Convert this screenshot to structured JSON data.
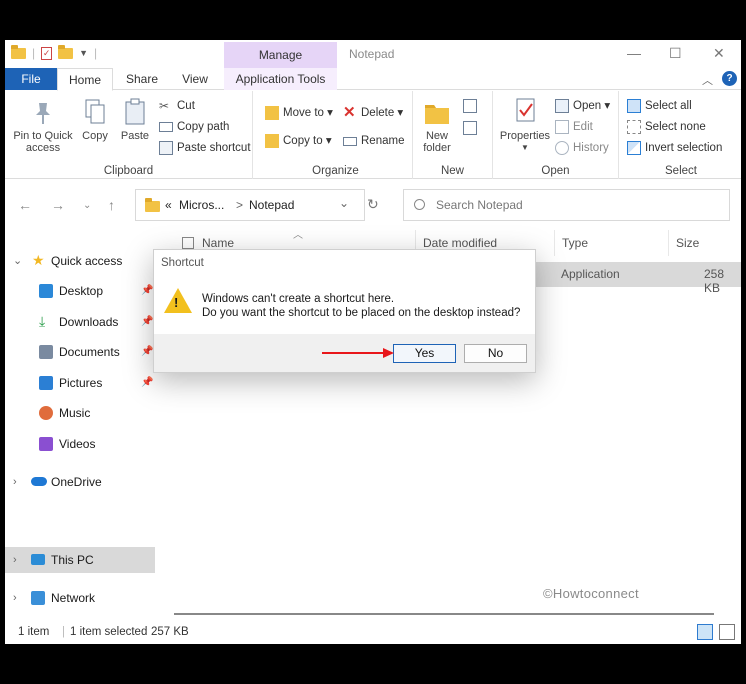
{
  "window": {
    "title": "Notepad",
    "manage_tab": "Manage",
    "controls": {
      "minimize": "—",
      "maximize": "☐",
      "close": "✕"
    }
  },
  "tabs": {
    "file": "File",
    "home": "Home",
    "share": "Share",
    "view": "View",
    "app_tools": "Application Tools"
  },
  "ribbon": {
    "clipboard": {
      "label": "Clipboard",
      "pin": "Pin to Quick access",
      "pin_l1": "Pin to Quick",
      "pin_l2": "access",
      "copy": "Copy",
      "paste": "Paste",
      "cut": "Cut",
      "copy_path": "Copy path",
      "paste_shortcut": "Paste shortcut"
    },
    "organize": {
      "label": "Organize",
      "move_to": "Move to ▾",
      "delete": "Delete ▾",
      "copy_to": "Copy to ▾",
      "rename": "Rename"
    },
    "new": {
      "label": "New",
      "new_folder_l1": "New",
      "new_folder_l2": "folder"
    },
    "open": {
      "label": "Open",
      "properties": "Properties",
      "open": "Open ▾",
      "edit": "Edit",
      "history": "History"
    },
    "select": {
      "label": "Select",
      "select_all": "Select all",
      "select_none": "Select none",
      "invert": "Invert selection"
    }
  },
  "address": {
    "crumb_prefix": "«",
    "crumb1": "Micros...",
    "sep": ">",
    "crumb2": "Notepad",
    "search_placeholder": "Search Notepad"
  },
  "nav": {
    "quick_access": "Quick access",
    "items": [
      {
        "label": "Desktop",
        "icon": "desktop-icon",
        "color": "#2b88d8"
      },
      {
        "label": "Downloads",
        "icon": "download-icon",
        "color": "#2a9d4a"
      },
      {
        "label": "Documents",
        "icon": "documents-icon",
        "color": "#7a8aa0"
      },
      {
        "label": "Pictures",
        "icon": "pictures-icon",
        "color": "#2b7fd4"
      },
      {
        "label": "Music",
        "icon": "music-icon",
        "color": "#e06c3c"
      },
      {
        "label": "Videos",
        "icon": "videos-icon",
        "color": "#8a4fd1"
      }
    ],
    "onedrive": "OneDrive",
    "this_pc": "This PC",
    "network": "Network"
  },
  "columns": {
    "name": "Name",
    "date": "Date modified",
    "type": "Type",
    "size": "Size"
  },
  "file_row": {
    "type": "Application",
    "size": "258 KB"
  },
  "status": {
    "count": "1 item",
    "selected": "1 item selected",
    "size": "257 KB"
  },
  "dialog": {
    "title": "Shortcut",
    "line1": "Windows can't create a shortcut here.",
    "line2": "Do you want the shortcut to be placed on the desktop instead?",
    "yes": "Yes",
    "no": "No"
  },
  "watermark": "©Howtoconnect",
  "colors": {
    "accent": "#1e63b6",
    "manage": "#e6d5f7",
    "arrow": "#e8161a",
    "warning": "#f2c01e"
  }
}
